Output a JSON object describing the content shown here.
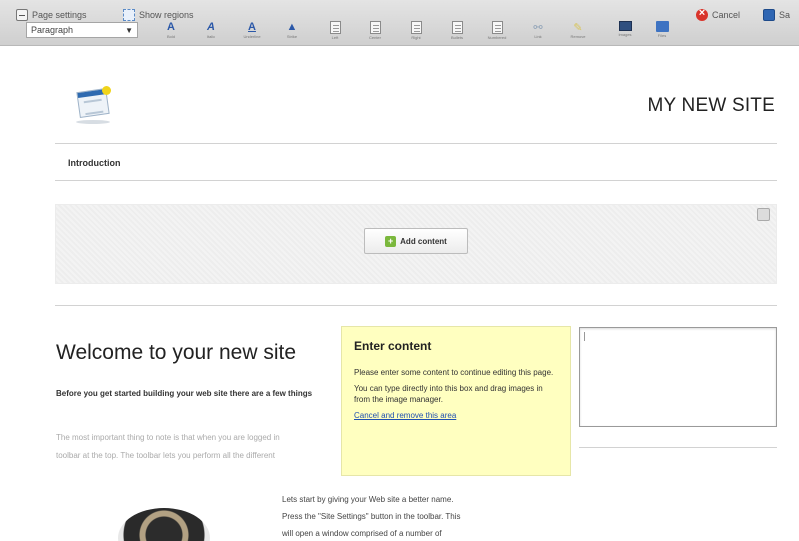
{
  "toolbar": {
    "page_settings_label": "Page settings",
    "show_regions_label": "Show regions",
    "cancel_label": "Cancel",
    "save_label": "Sa",
    "format_select_value": "Paragraph",
    "tools": [
      {
        "name": "bold-tool",
        "icon": "bold-icon",
        "label": "Bold"
      },
      {
        "name": "italic-tool",
        "icon": "italic-icon",
        "label": "Italic"
      },
      {
        "name": "underline-tool",
        "icon": "underline-icon",
        "label": "Underline"
      },
      {
        "name": "strike-tool",
        "icon": "strike-icon",
        "label": "Strike"
      },
      {
        "name": "align-left-tool",
        "icon": "align-left-icon",
        "label": "Left"
      },
      {
        "name": "align-center-tool",
        "icon": "align-center-icon",
        "label": "Center"
      },
      {
        "name": "align-right-tool",
        "icon": "align-right-icon",
        "label": "Right"
      },
      {
        "name": "bullets-tool",
        "icon": "bullets-icon",
        "label": "Bullets"
      },
      {
        "name": "numbered-tool",
        "icon": "numbered-icon",
        "label": "Numbered"
      },
      {
        "name": "link-tool",
        "icon": "link-icon",
        "label": "Link"
      },
      {
        "name": "remove-link-tool",
        "icon": "remove-link-icon",
        "label": "Remove"
      },
      {
        "name": "images-tool",
        "icon": "image-icon",
        "label": "Images"
      },
      {
        "name": "files-tool",
        "icon": "folder-icon",
        "label": "Files"
      }
    ]
  },
  "site": {
    "title": "MY NEW SITE"
  },
  "nav": {
    "intro_label": "Introduction"
  },
  "region": {
    "add_content_label": "Add content"
  },
  "content": {
    "heading": "Welcome to your new site",
    "intro_bold": "Before you get started building your web site there are a few things",
    "body_lines": [
      "The most important thing to note is that when you are logged in",
      "toolbar at the top. The toolbar lets you perform all the different"
    ],
    "para2_lines": [
      "Lets start by giving your Web site a better name.",
      "Press the \"Site Settings\" button in the toolbar. This",
      "will open a window comprised of a number of"
    ]
  },
  "tooltip": {
    "title": "Enter content",
    "line1": "Please enter some content to continue editing this page.",
    "line2": "You can type directly into this box and drag images in from the image manager.",
    "link": "Cancel and remove this area"
  },
  "colors": {
    "tooltip_bg": "#ffffc0",
    "link": "#1f4fb0",
    "toolbar_bg": "#d9d9d9"
  }
}
